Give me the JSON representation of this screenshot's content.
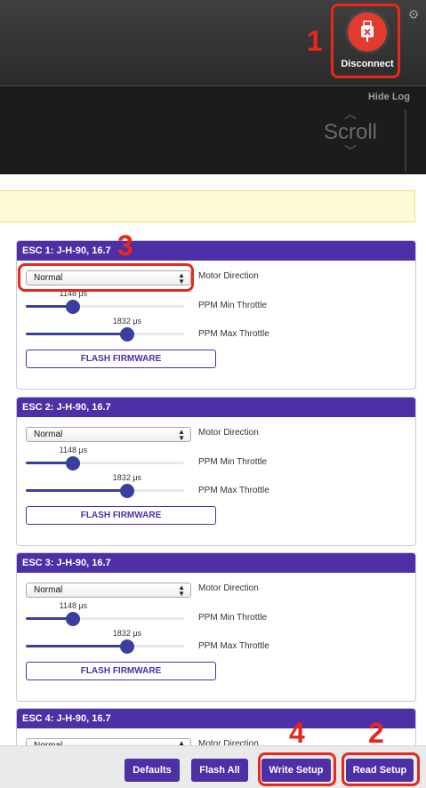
{
  "header": {
    "disconnect_label": "Disconnect",
    "icons": {
      "disconnect": "usb-disconnect-icon",
      "settings": "gear-icon"
    }
  },
  "log": {
    "hide_label": "Hide Log",
    "scroll_label": "Scroll"
  },
  "escs": [
    {
      "title": "ESC 1: J-H-90, 16.7",
      "motor_direction": "Normal",
      "motor_direction_label": "Motor Direction",
      "min_throttle": "1148 μs",
      "min_label": "PPM Min Throttle",
      "min_fraction": 0.3,
      "max_throttle": "1832 μs",
      "max_label": "PPM Max Throttle",
      "max_fraction": 0.64,
      "flash_label": "FLASH FIRMWARE"
    },
    {
      "title": "ESC 2: J-H-90, 16.7",
      "motor_direction": "Normal",
      "motor_direction_label": "Motor Direction",
      "min_throttle": "1148 μs",
      "min_label": "PPM Min Throttle",
      "min_fraction": 0.3,
      "max_throttle": "1832 μs",
      "max_label": "PPM Max Throttle",
      "max_fraction": 0.64,
      "flash_label": "FLASH FIRMWARE"
    },
    {
      "title": "ESC 3: J-H-90, 16.7",
      "motor_direction": "Normal",
      "motor_direction_label": "Motor Direction",
      "min_throttle": "1148 μs",
      "min_label": "PPM Min Throttle",
      "min_fraction": 0.3,
      "max_throttle": "1832 μs",
      "max_label": "PPM Max Throttle",
      "max_fraction": 0.64,
      "flash_label": "FLASH FIRMWARE"
    },
    {
      "title": "ESC 4: J-H-90, 16.7",
      "motor_direction": "Normal",
      "motor_direction_label": "Motor Direction"
    }
  ],
  "footer": {
    "defaults": "Defaults",
    "flash_all": "Flash All",
    "write_setup": "Write Setup",
    "read_setup": "Read Setup"
  },
  "annotations": [
    "1",
    "2",
    "3",
    "4"
  ],
  "colors": {
    "accent": "#4d2fa6",
    "disconnect": "#e23b2e",
    "annotation": "#e8281a",
    "slider": "#3a3f9e"
  }
}
